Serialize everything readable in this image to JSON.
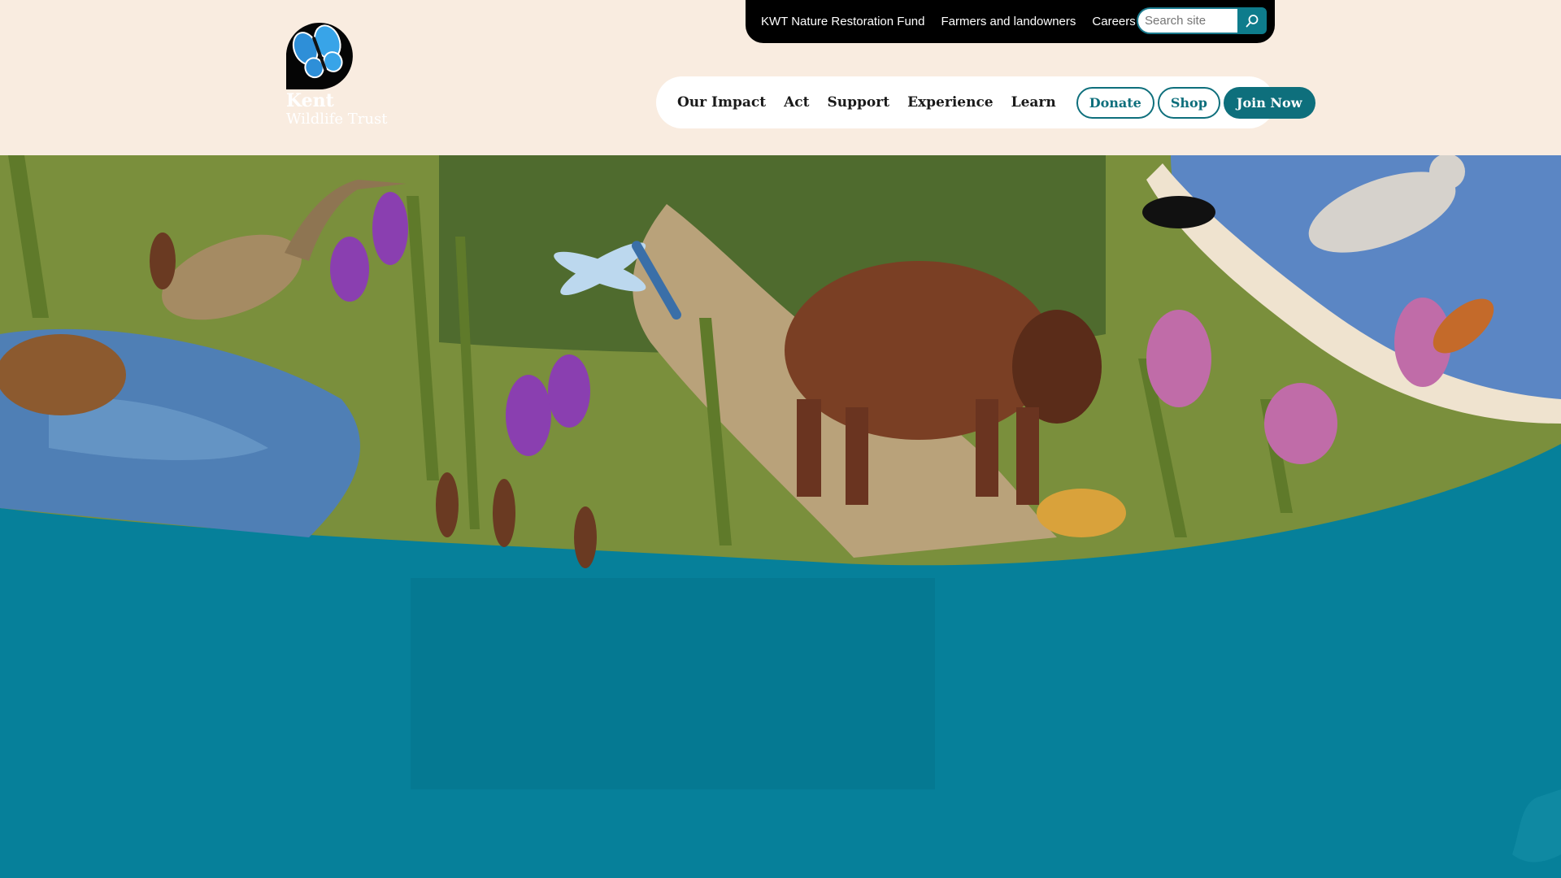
{
  "logo": {
    "name": "Kent",
    "subtitle": "Wildlife Trust"
  },
  "utility_nav": {
    "links": [
      "KWT Nature Restoration Fund",
      "Farmers and landowners",
      "Careers"
    ],
    "search_placeholder": "Search site"
  },
  "main_nav": {
    "items": [
      "Our Impact",
      "Act",
      "Support",
      "Experience",
      "Learn"
    ],
    "donate": "Donate",
    "shop": "Shop",
    "join": "Join Now"
  },
  "colors": {
    "background": "#f9ece0",
    "teal": "#06809a",
    "accent": "#0e6f7c",
    "utility_bar": "#000000"
  },
  "icons": [
    "butterfly-logo-icon",
    "search-icon"
  ]
}
